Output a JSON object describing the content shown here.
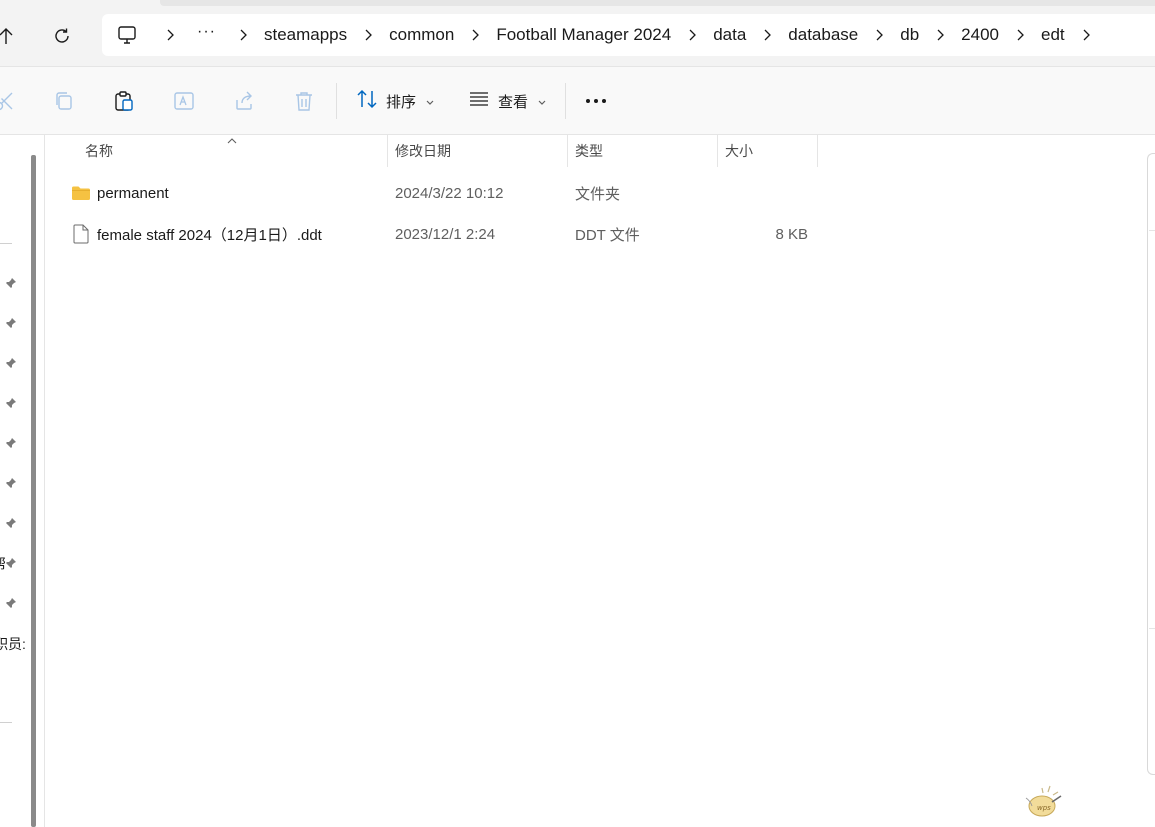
{
  "address_bar": {
    "overflow": "···",
    "crumbs": [
      "steamapps",
      "common",
      "Football Manager 2024",
      "data",
      "database",
      "db",
      "2400",
      "edt"
    ]
  },
  "toolbar": {
    "sort_label": "排序",
    "view_label": "查看",
    "more_label": "···"
  },
  "nav_pane": {
    "fragments": [
      "帮",
      "职员:"
    ]
  },
  "columns": {
    "name": "名称",
    "modified": "修改日期",
    "type": "类型",
    "size": "大小"
  },
  "files": [
    {
      "name": "permanent",
      "modified": "2024/3/22 10:12",
      "type": "文件夹",
      "size": "",
      "icon": "folder-icon"
    },
    {
      "name": "female staff 2024（12月1日）.ddt",
      "modified": "2023/12/1 2:24",
      "type": "DDT 文件",
      "size": "8 KB",
      "icon": "file-icon"
    }
  ],
  "watermark": {
    "text": "wps"
  },
  "colors": {
    "folder": "#f5c242",
    "accent": "#0067c0",
    "icon_disabled": "#a9c6e6"
  }
}
